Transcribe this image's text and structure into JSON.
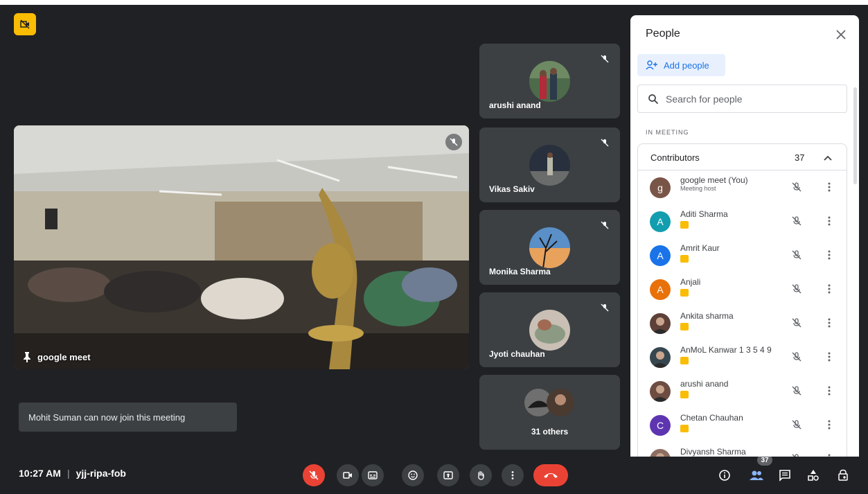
{
  "meeting": {
    "time": "10:27 AM",
    "separator": "|",
    "code": "yjj-ripa-fob"
  },
  "main_tile": {
    "name": "google meet"
  },
  "side_tiles": [
    {
      "name": "arushi anand"
    },
    {
      "name": "Vikas Sakiv"
    },
    {
      "name": "Monika Sharma"
    },
    {
      "name": "Jyoti chauhan"
    }
  ],
  "others_tile": {
    "label": "31 others"
  },
  "toast": {
    "text": "Mohit Suman can now join this meeting"
  },
  "people_count_badge": "37",
  "panel": {
    "title": "People",
    "add_people_label": "Add people",
    "search_placeholder": "Search for people",
    "section_label": "IN MEETING",
    "group_label": "Contributors",
    "group_count": "37"
  },
  "participants": [
    {
      "name": "google meet (You)",
      "sub": "Meeting host",
      "initial": "g",
      "color": "#795548",
      "photo": false
    },
    {
      "name": "Aditi Sharma",
      "initial": "A",
      "color": "#129eaf",
      "photo": false
    },
    {
      "name": "Amrit Kaur",
      "initial": "A",
      "color": "#1a73e8",
      "photo": false
    },
    {
      "name": "Anjali",
      "initial": "A",
      "color": "#e8710a",
      "photo": false
    },
    {
      "name": "Ankita sharma",
      "initial": "",
      "color": "#5d4037",
      "photo": true
    },
    {
      "name": "AnMoL Kanwar 1 3 5 4 9",
      "initial": "",
      "color": "#37474f",
      "photo": true
    },
    {
      "name": "arushi anand",
      "initial": "",
      "color": "#6d4c41",
      "photo": true
    },
    {
      "name": "Chetan Chauhan",
      "initial": "C",
      "color": "#5e35b1",
      "photo": false
    },
    {
      "name": "Divyansh Sharma",
      "initial": "",
      "color": "#8d6e63",
      "photo": true
    }
  ],
  "colors": {
    "stage": "#202124",
    "tile": "#3c4043",
    "end_call": "#ea4335",
    "accent": "#1a73e8",
    "highlight": "#fbbc04"
  },
  "icons": {
    "recording": "recording-off-icon",
    "mic_off": "mic-off-icon",
    "camera": "camera-icon",
    "captions": "captions-icon",
    "emoji": "emoji-icon",
    "present": "present-icon",
    "hand": "raise-hand-icon",
    "more": "more-vert-icon",
    "end_call": "end-call-icon",
    "info": "info-icon",
    "people": "people-icon",
    "chat": "chat-icon",
    "activities": "activities-icon",
    "host_controls": "lock-person-icon"
  }
}
